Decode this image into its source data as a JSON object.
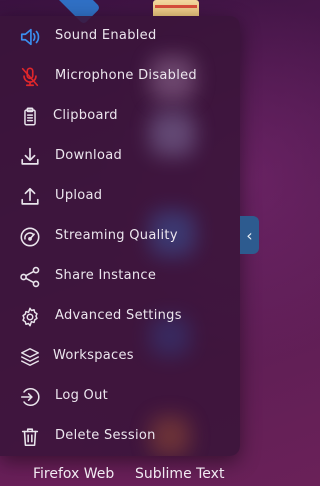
{
  "menu": {
    "items": [
      {
        "label": "Sound Enabled",
        "icon": "speaker-icon",
        "color": "#3b8ff0"
      },
      {
        "label": "Microphone Disabled",
        "icon": "microphone-muted-icon",
        "color": "#e0272b"
      },
      {
        "label": "Clipboard",
        "icon": "clipboard-icon",
        "color": "#e9e4ec"
      },
      {
        "label": "Download",
        "icon": "download-icon",
        "color": "#e9e4ec"
      },
      {
        "label": "Upload",
        "icon": "upload-icon",
        "color": "#e9e4ec"
      },
      {
        "label": "Streaming Quality",
        "icon": "gauge-icon",
        "color": "#e9e4ec"
      },
      {
        "label": "Share Instance",
        "icon": "share-icon",
        "color": "#e9e4ec"
      },
      {
        "label": "Advanced Settings",
        "icon": "gear-icon",
        "color": "#e9e4ec"
      },
      {
        "label": "Workspaces",
        "icon": "layers-icon",
        "color": "#e9e4ec"
      },
      {
        "label": "Log Out",
        "icon": "logout-icon",
        "color": "#e9e4ec"
      },
      {
        "label": "Delete Session",
        "icon": "trash-icon",
        "color": "#e9e4ec"
      }
    ],
    "collapse_glyph": "‹"
  },
  "dock": {
    "firefox_label": "Firefox Web",
    "sublime_label": "Sublime Text"
  }
}
